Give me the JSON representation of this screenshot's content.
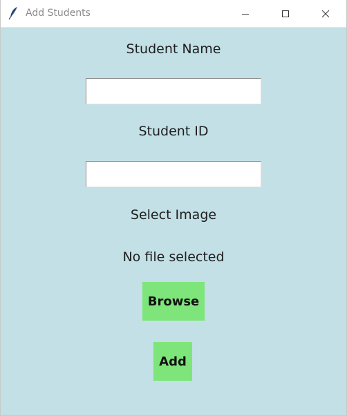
{
  "window": {
    "title": "Add Students",
    "icon": "feather-icon",
    "controls": [
      "minimize-icon",
      "maximize-icon",
      "close-icon"
    ]
  },
  "form": {
    "student_name_label": "Student Name",
    "student_name_value": "",
    "student_id_label": "Student ID",
    "student_id_value": "",
    "select_image_label": "Select Image",
    "file_status": "No file selected",
    "browse_button": "Browse",
    "add_button": "Add"
  },
  "colors": {
    "background": "#c2e0e5",
    "button": "#7ee57a",
    "titlebar": "#ffffff"
  }
}
